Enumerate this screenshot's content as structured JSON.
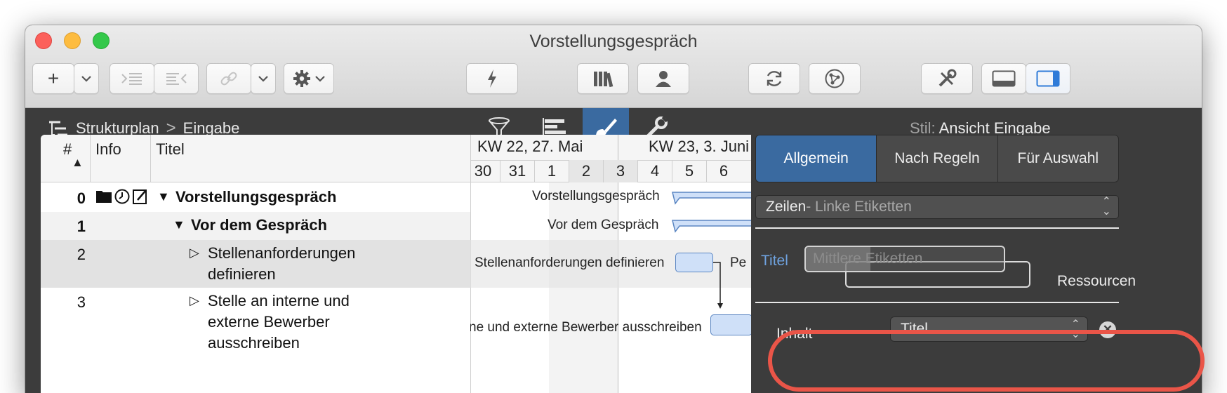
{
  "window": {
    "title": "Vorstellungsgespräch"
  },
  "toolbar": {
    "add": "+",
    "add_menu": "chevron-down",
    "indent": "indent-icon",
    "outdent": "outdent-icon",
    "link": "link-icon",
    "link_menu": "chevron-down",
    "gear": "gear-icon",
    "gear_menu": "chevron-down",
    "level": "lightning-icon",
    "library": "library-icon",
    "resource": "person-icon",
    "sync": "sync-icon",
    "network": "network-icon",
    "tools": "tools-icon",
    "bottom_panel": "bottom-panel-icon",
    "side_panel": "side-panel-icon"
  },
  "header": {
    "breadcrumb_root": "Strukturplan",
    "breadcrumb_sep": ">",
    "breadcrumb_child": "Eingabe",
    "style_label": "Stil:",
    "style_value": "Ansicht Eingabe"
  },
  "table": {
    "col_num": "#",
    "sort_indicator": "▲",
    "col_info": "Info",
    "col_title": "Titel",
    "rows": [
      {
        "num": "0",
        "title": "Vorstellungsgespräch",
        "triangle": "▼",
        "info_icons": [
          "folder-icon",
          "clock-icon",
          "note-icon"
        ]
      },
      {
        "num": "1",
        "title": "Vor dem Gespräch",
        "triangle": "▼"
      },
      {
        "num": "2",
        "title_l1": "Stellenanforderungen",
        "title_l2": "definieren",
        "triangle": "▷"
      },
      {
        "num": "3",
        "title_l1": "Stelle an interne und",
        "title_l2": "externe Bewerber",
        "title_l3": "ausschreiben",
        "triangle": "▷"
      }
    ]
  },
  "gantt": {
    "week1": "KW 22, 27. Mai",
    "week2": "KW 23, 3. Juni",
    "days": [
      "30",
      "31",
      "1",
      "2",
      "3",
      "4",
      "5",
      "6"
    ],
    "labels": {
      "row0": "Vorstellungsgespräch",
      "row1": "Vor dem Gespräch",
      "row2": "Stellenanforderungen definieren",
      "row2_right": "Pe",
      "row3": "ne und externe Bewerber ausschreiben"
    }
  },
  "inspector": {
    "tabs": [
      "Allgemein",
      "Nach Regeln",
      "Für Auswahl"
    ],
    "active_tab": "Allgemein",
    "section_popup_main": "Zeilen",
    "section_popup_sub": " - Linke Etiketten",
    "label_titel": "Titel",
    "label_mid": "Mittlere Etiketten",
    "label_res": "Ressourcen",
    "content_label": "Inhalt",
    "content_value": "Titel",
    "remove": "✕"
  },
  "colors": {
    "accent_blue": "#3a6aa0",
    "highlight_red": "#ea5548",
    "gantt_bar": "#cfe0f8"
  }
}
